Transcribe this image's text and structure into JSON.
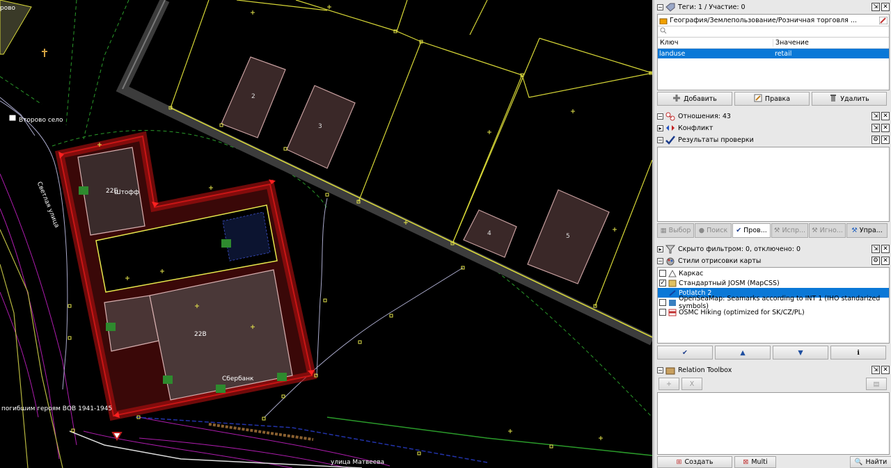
{
  "map": {
    "labels": {
      "village": "Второво село",
      "shop": "Штофф",
      "house_22b": "22Б",
      "house_22v": "22В",
      "bank": "Сбербанк",
      "memorial": "погибшим героям ВОВ 1941-1945",
      "street_bottom": "улица Матвеева",
      "street_left": "Светлая улица",
      "corner_text": "рово",
      "b2": "2",
      "b3": "3",
      "b4": "4",
      "b5": "5"
    }
  },
  "tags_panel": {
    "title": "Теги: 1 / Участие: 0",
    "preset": "География/Землепользование/Розничная торговля ...",
    "search_placeholder": "",
    "col_key": "Ключ",
    "col_value": "Значение",
    "rows": [
      {
        "key": "landuse",
        "value": "retail"
      }
    ],
    "buttons": {
      "add": "Добавить",
      "edit": "Правка",
      "delete": "Удалить"
    }
  },
  "relations_panel": {
    "title": "Отношения: 43"
  },
  "conflict_panel": {
    "title": "Конфликт"
  },
  "validation_panel": {
    "title": "Результаты проверки",
    "tabs": [
      "Выбор",
      "Поиск",
      "Пров...",
      "Испр...",
      "Игно...",
      "Упра..."
    ]
  },
  "filter_panel": {
    "title": "Скрыто фильтром: 0, отключено: 0"
  },
  "styles_panel": {
    "title": "Стили отрисовки карты",
    "items": [
      {
        "label": "Каркас",
        "checked": false
      },
      {
        "label": "Стандартный JOSM (MapCSS)",
        "checked": true
      },
      {
        "label": "Potlatch 2",
        "checked": false
      },
      {
        "label": "OpenSeaMap: Seamarks according to INT 1 (IHO standarized symbols)",
        "checked": false
      },
      {
        "label": "OSMC Hiking (optimized for SK/CZ/PL)",
        "checked": false
      }
    ]
  },
  "relation_toolbox": {
    "title": "Relation Toolbox",
    "buttons": {
      "create": "Создать",
      "multi": "Multi",
      "find": "Найти"
    }
  },
  "colors": {
    "panel_bg": "#e8e8e8",
    "selection": "#0a78d7",
    "map_bg": "#000000",
    "selected_way": "#ff2020",
    "building_line": "#e6e64c"
  }
}
